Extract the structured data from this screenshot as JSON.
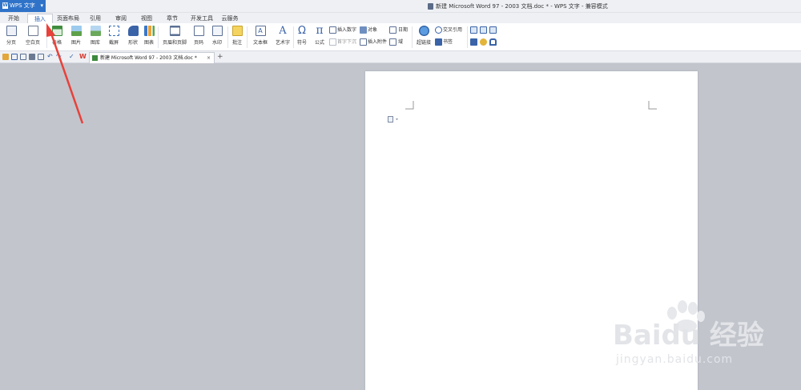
{
  "app": {
    "name": "WPS 文字"
  },
  "window_title": "新建 Microsoft Word 97 - 2003 文档.doc * - WPS 文字 - 兼容模式",
  "menu_tabs": [
    "开始",
    "插入",
    "页面布局",
    "引用",
    "审阅",
    "视图",
    "章节",
    "开发工具",
    "云服务"
  ],
  "active_tab": "插入",
  "ribbon": {
    "page_break": "分页",
    "blank_page": "空白页",
    "table": "表格",
    "picture": "图片",
    "gallery": "图库",
    "screenshot": "截屏",
    "shape": "形状",
    "chart": "图表",
    "header_footer": "页眉和页脚",
    "page_number": "页码",
    "watermark": "水印",
    "comment": "批注",
    "textbox": "文本框",
    "wordart": "艺术字",
    "symbol": "符号",
    "formula": "公式",
    "insert_number": "插入数字",
    "object": "对象",
    "date": "日期",
    "first_letter_sink": "首字下沉",
    "insert_attachment": "插入附件",
    "field": "域",
    "hyperlink": "超链接",
    "cross_reference": "交叉引用",
    "bookmark": "书签"
  },
  "doc_tab": {
    "title": "新建 Microsoft Word 97 - 2003 文档.doc *"
  },
  "watermark": {
    "brand": "Baidu 经验",
    "url": "jingyan.baidu.com"
  },
  "colors": {
    "app_blue": "#2f73c9",
    "arrow_red": "#e8413a"
  }
}
